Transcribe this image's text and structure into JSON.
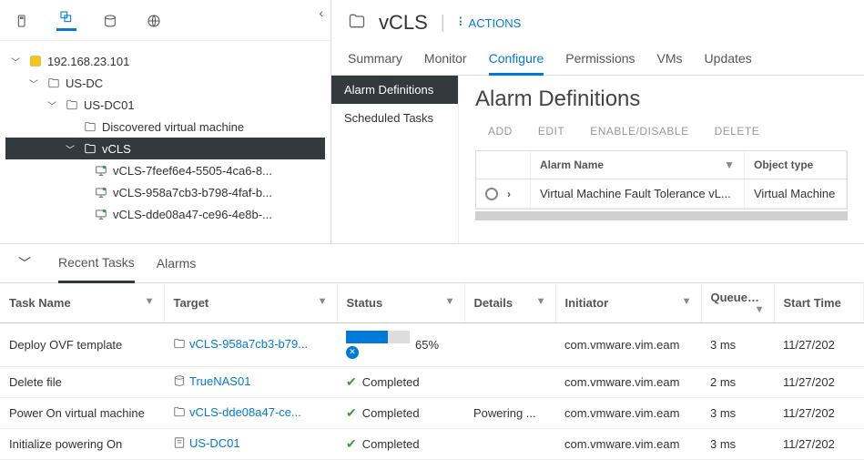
{
  "tree": {
    "root": "192.168.23.101",
    "dc": "US-DC",
    "cluster": "US-DC01",
    "discovered": "Discovered virtual machine",
    "vcls_folder": "vCLS",
    "vms": [
      "vCLS-7feef6e4-5505-4ca6-8...",
      "vCLS-958a7cb3-b798-4faf-b...",
      "vCLS-dde08a47-ce96-4e8b-..."
    ]
  },
  "header": {
    "title": "vCLS",
    "actions": "ACTIONS"
  },
  "tabs": [
    "Summary",
    "Monitor",
    "Configure",
    "Permissions",
    "VMs",
    "Updates"
  ],
  "sidebar": {
    "items": [
      "Alarm Definitions",
      "Scheduled Tasks"
    ]
  },
  "config": {
    "heading": "Alarm Definitions",
    "actions": [
      "ADD",
      "EDIT",
      "ENABLE/DISABLE",
      "DELETE"
    ],
    "columns": {
      "name": "Alarm Name",
      "type": "Object type"
    },
    "row": {
      "name": "Virtual Machine Fault Tolerance vL...",
      "type": "Virtual Machine"
    }
  },
  "bottom": {
    "tabs": [
      "Recent Tasks",
      "Alarms"
    ],
    "columns": [
      "Task Name",
      "Target",
      "Status",
      "Details",
      "Initiator",
      "Queued For",
      "Start Time"
    ],
    "rows": [
      {
        "name": "Deploy OVF template",
        "target": "vCLS-958a7cb3-b79...",
        "status": "progress",
        "percent": 65,
        "percent_label": "65%",
        "details": "",
        "initiator": "com.vmware.vim.eam",
        "queued": "3 ms",
        "start": "11/27/202",
        "target_icon": "folder"
      },
      {
        "name": "Delete file",
        "target": "TrueNAS01",
        "status": "completed",
        "status_label": "Completed",
        "details": "",
        "initiator": "com.vmware.vim.eam",
        "queued": "2 ms",
        "start": "11/27/202",
        "target_icon": "datastore"
      },
      {
        "name": "Power On virtual machine",
        "target": "vCLS-dde08a47-ce...",
        "status": "completed",
        "status_label": "Completed",
        "details": "Powering ...",
        "initiator": "com.vmware.vim.eam",
        "queued": "3 ms",
        "start": "11/27/202",
        "target_icon": "folder"
      },
      {
        "name": "Initialize powering On",
        "target": "US-DC01",
        "status": "completed",
        "status_label": "Completed",
        "details": "",
        "initiator": "com.vmware.vim.eam",
        "queued": "3 ms",
        "start": "11/27/202",
        "target_icon": "host"
      }
    ]
  }
}
